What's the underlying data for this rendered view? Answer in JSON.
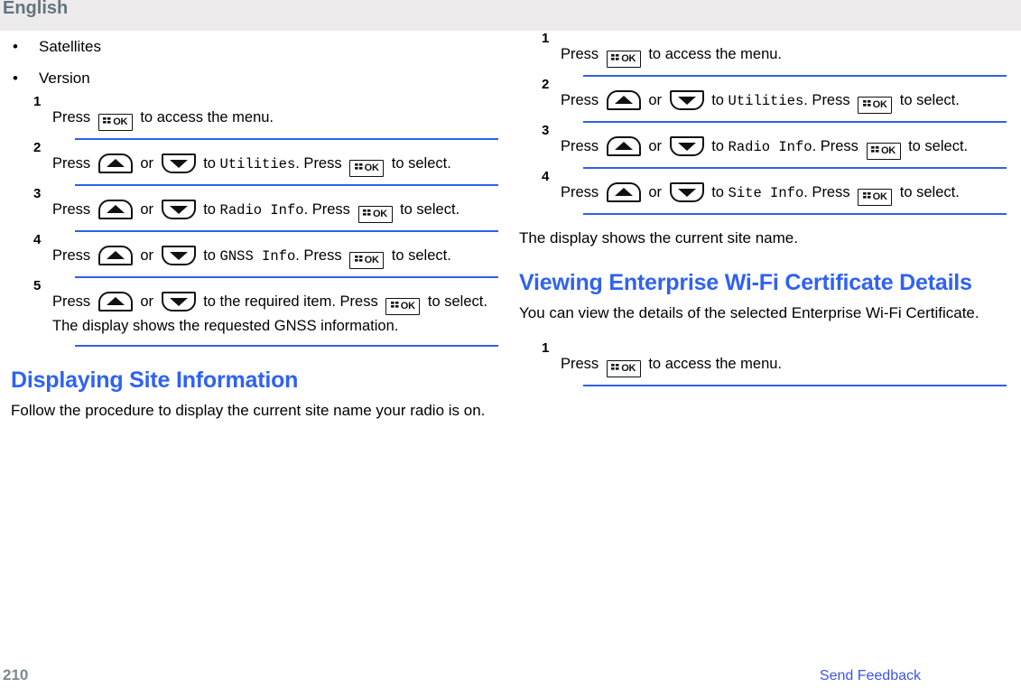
{
  "header": {
    "language_label": "English",
    "band_color": "#eceaea",
    "text_color": "#62757f"
  },
  "theme": {
    "heading_blue": "#2f62f2",
    "rule_blue": "#3160e8",
    "link_blue": "#3b55e8",
    "page_number_gray": "#7a8a92"
  },
  "icons": {
    "ok_key": "ok-menu-key-icon",
    "up_key": "up-arrow-key-icon",
    "down_key": "down-arrow-key-icon",
    "ok_label": "OK"
  },
  "left_column": {
    "bullets": [
      {
        "bullet": "•",
        "label": "Satellites"
      },
      {
        "bullet": "•",
        "label": "Version"
      }
    ],
    "steps": [
      {
        "number": "1",
        "parts": [
          {
            "type": "text",
            "value": "Press "
          },
          {
            "type": "key",
            "key": "ok"
          },
          {
            "type": "text",
            "value": " to access the menu."
          }
        ]
      },
      {
        "number": "2",
        "parts": [
          {
            "type": "text",
            "value": "Press "
          },
          {
            "type": "key",
            "key": "up"
          },
          {
            "type": "text",
            "value": " or "
          },
          {
            "type": "key",
            "key": "down"
          },
          {
            "type": "text",
            "value": " to "
          },
          {
            "type": "mono",
            "value": "Utilities"
          },
          {
            "type": "text",
            "value": ". Press "
          },
          {
            "type": "key",
            "key": "ok"
          },
          {
            "type": "text",
            "value": " to select."
          }
        ]
      },
      {
        "number": "3",
        "parts": [
          {
            "type": "text",
            "value": "Press "
          },
          {
            "type": "key",
            "key": "up"
          },
          {
            "type": "text",
            "value": " or "
          },
          {
            "type": "key",
            "key": "down"
          },
          {
            "type": "text",
            "value": " to "
          },
          {
            "type": "mono",
            "value": "Radio Info"
          },
          {
            "type": "text",
            "value": ". Press "
          },
          {
            "type": "key",
            "key": "ok"
          },
          {
            "type": "text",
            "value": " to select."
          }
        ]
      },
      {
        "number": "4",
        "parts": [
          {
            "type": "text",
            "value": "Press "
          },
          {
            "type": "key",
            "key": "up"
          },
          {
            "type": "text",
            "value": " or "
          },
          {
            "type": "key",
            "key": "down"
          },
          {
            "type": "text",
            "value": " to "
          },
          {
            "type": "mono",
            "value": "GNSS Info"
          },
          {
            "type": "text",
            "value": ". Press "
          },
          {
            "type": "key",
            "key": "ok"
          },
          {
            "type": "text",
            "value": " to select."
          }
        ]
      },
      {
        "number": "5",
        "parts": [
          {
            "type": "text",
            "value": "Press "
          },
          {
            "type": "key",
            "key": "up"
          },
          {
            "type": "text",
            "value": " or "
          },
          {
            "type": "key",
            "key": "down"
          },
          {
            "type": "text",
            "value": " to the required item. Press "
          },
          {
            "type": "key",
            "key": "ok"
          },
          {
            "type": "text",
            "value": " to select. The display shows the requested GNSS information."
          }
        ]
      }
    ],
    "section": {
      "heading": "Displaying Site Information",
      "paragraph": "Follow the procedure to display the current site name your radio is on."
    }
  },
  "right_column": {
    "steps": [
      {
        "number": "1",
        "parts": [
          {
            "type": "text",
            "value": "Press "
          },
          {
            "type": "key",
            "key": "ok"
          },
          {
            "type": "text",
            "value": " to access the menu."
          }
        ]
      },
      {
        "number": "2",
        "parts": [
          {
            "type": "text",
            "value": "Press "
          },
          {
            "type": "key",
            "key": "up"
          },
          {
            "type": "text",
            "value": " or "
          },
          {
            "type": "key",
            "key": "down"
          },
          {
            "type": "text",
            "value": " to "
          },
          {
            "type": "mono",
            "value": "Utilities"
          },
          {
            "type": "text",
            "value": ". Press "
          },
          {
            "type": "key",
            "key": "ok"
          },
          {
            "type": "text",
            "value": " to select."
          }
        ]
      },
      {
        "number": "3",
        "parts": [
          {
            "type": "text",
            "value": "Press "
          },
          {
            "type": "key",
            "key": "up"
          },
          {
            "type": "text",
            "value": " or "
          },
          {
            "type": "key",
            "key": "down"
          },
          {
            "type": "text",
            "value": " to "
          },
          {
            "type": "mono",
            "value": "Radio Info"
          },
          {
            "type": "text",
            "value": ". Press "
          },
          {
            "type": "key",
            "key": "ok"
          },
          {
            "type": "text",
            "value": " to select."
          }
        ]
      },
      {
        "number": "4",
        "parts": [
          {
            "type": "text",
            "value": "Press "
          },
          {
            "type": "key",
            "key": "up"
          },
          {
            "type": "text",
            "value": " or "
          },
          {
            "type": "key",
            "key": "down"
          },
          {
            "type": "text",
            "value": " to "
          },
          {
            "type": "mono",
            "value": "Site Info"
          },
          {
            "type": "text",
            "value": ". Press "
          },
          {
            "type": "key",
            "key": "ok"
          },
          {
            "type": "text",
            "value": " to select."
          }
        ]
      }
    ],
    "result_text": "The display shows the current site name.",
    "section": {
      "heading": "Viewing Enterprise Wi-Fi Certificate Details",
      "paragraph": "You can view the details of the selected Enterprise Wi-Fi Certificate."
    },
    "steps2": [
      {
        "number": "1",
        "parts": [
          {
            "type": "text",
            "value": "Press "
          },
          {
            "type": "key",
            "key": "ok"
          },
          {
            "type": "text",
            "value": " to access the menu."
          }
        ]
      }
    ]
  },
  "footer": {
    "page_number": "210",
    "send_feedback_label": "Send Feedback"
  }
}
